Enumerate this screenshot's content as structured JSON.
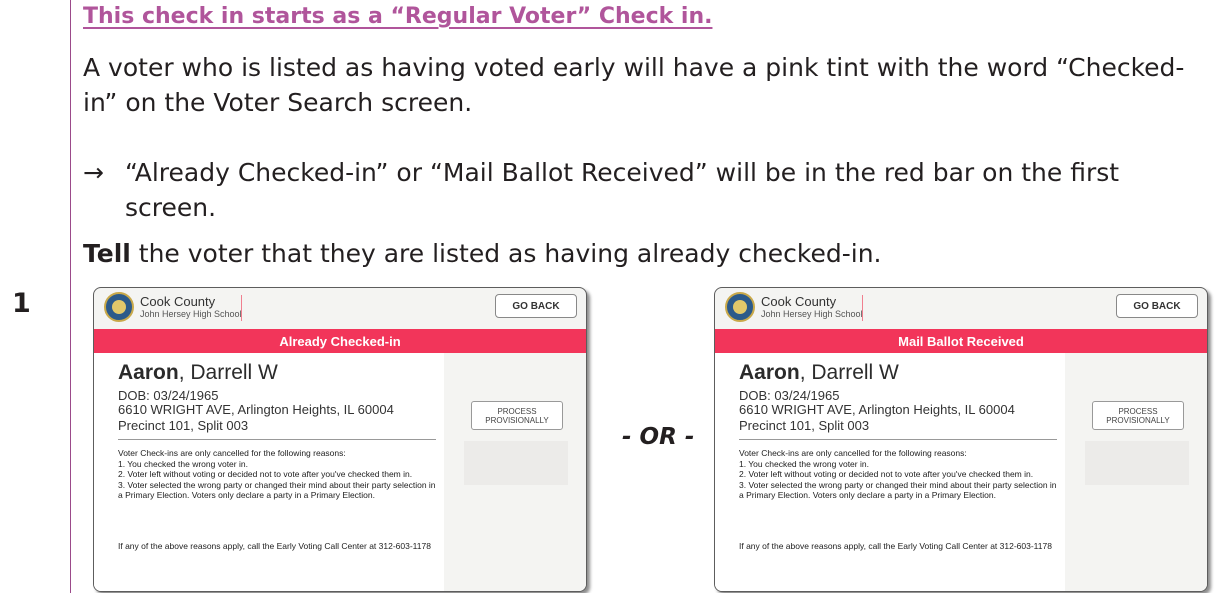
{
  "step_number": "1",
  "heading": "This check in starts as a “Regular Voter” Check in.",
  "para1": "A voter who is listed as having voted early will have a pink tint with the word “Checked-in” on the Voter Search screen.",
  "arrow_symbol": "→",
  "arrow_text": "“Already Checked-in” or “Mail Ballot Received” will be in the red bar on the first screen.",
  "tell_bold": "Tell",
  "tell_rest": " the voter that they are listed as having already checked-in.",
  "or_text": "- OR -",
  "screens": [
    {
      "county": "Cook County",
      "school": "John Hersey High School",
      "go_back": "GO BACK",
      "bar": "Already Checked-in",
      "last_name": "Aaron",
      "first_name": ", Darrell W",
      "dob": "DOB: 03/24/1965",
      "address": "6610 WRIGHT AVE, Arlington Heights, IL 60004",
      "precinct": "Precinct 101, Split 003",
      "reasons": [
        "Voter Check-ins are only cancelled for the following reasons:",
        "1.   You checked the wrong voter in.",
        "2.   Voter left without voting or decided not to vote after you've checked them in.",
        "3.   Voter selected the wrong party or changed their mind about their party selection in a Primary Election.  Voters only declare a party in a Primary Election."
      ],
      "call_center": "If any of the above reasons apply, call the Early Voting Call Center at 312-603-1178",
      "process_button": "PROCESS PROVISIONALLY"
    },
    {
      "county": "Cook County",
      "school": "John Hersey High School",
      "go_back": "GO BACK",
      "bar": "Mail Ballot Received",
      "last_name": "Aaron",
      "first_name": ", Darrell W",
      "dob": "DOB: 03/24/1965",
      "address": "6610 WRIGHT AVE, Arlington Heights, IL 60004",
      "precinct": "Precinct 101, Split 003",
      "reasons": [
        "Voter Check-ins are only cancelled for the following reasons:",
        "1.   You checked the wrong voter in.",
        "2.   Voter left without voting or decided not to vote after you've checked them in.",
        "3.   Voter selected the wrong party or changed their mind about their party selection in a Primary Election.  Voters only declare a party in a Primary Election."
      ],
      "call_center": "If any of the above reasons apply, call the Early Voting Call Center at 312-603-1178",
      "process_button": "PROCESS PROVISIONALLY"
    }
  ],
  "colors": {
    "heading": "#b0559b",
    "red_bar": "#f2355a",
    "gutter_line": "#9b4a8a"
  }
}
